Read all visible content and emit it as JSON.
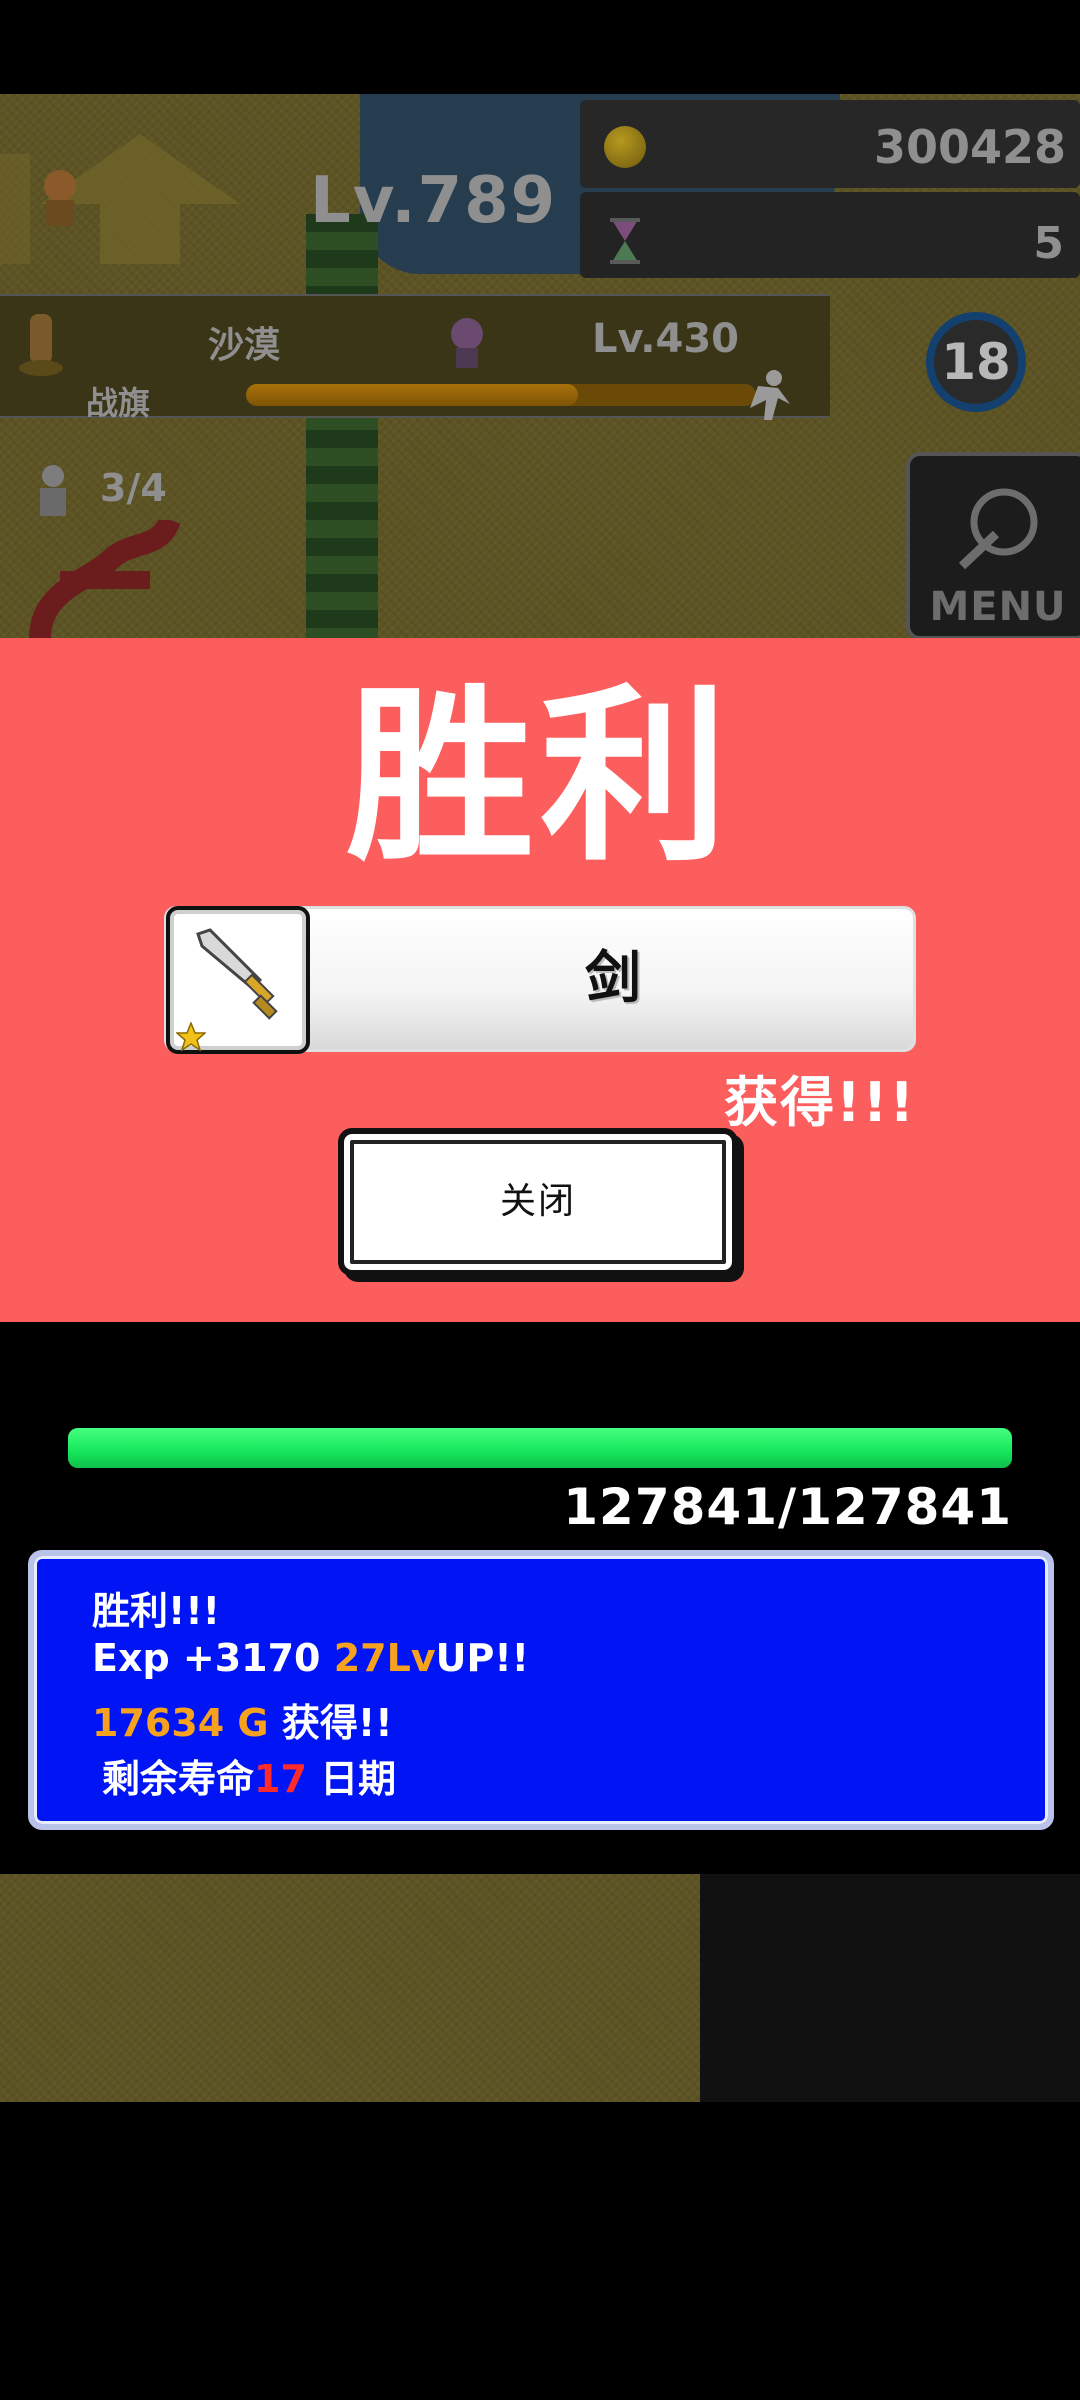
{
  "hud": {
    "player_level": "Lv.789",
    "gold": "300428",
    "hourglass": "5",
    "stage_name": "沙漠",
    "flag_label": "战旗",
    "enemy_level": "Lv.430",
    "stage_progress": 0.65,
    "round": "18",
    "party_count": "3/4",
    "menu_label": "MENU"
  },
  "modal": {
    "title": "胜利",
    "item_name": "剑",
    "obtained": "获得!!!",
    "close_label": "关闭",
    "background_color": "#fc5e5d"
  },
  "battle": {
    "hp_text": "127841/127841",
    "hp_fraction": 1.0
  },
  "log": {
    "line1": "胜利!!!",
    "line2_a": "Exp +3170 ",
    "line2_b": "27Lv",
    "line2_c": "UP!!",
    "line3_a": "17634 G ",
    "line3_b": "获得!!",
    "line4_a": "剩余寿命",
    "line4_b": "17",
    "line4_c": " 日期"
  },
  "icons": [
    "coin-icon",
    "hourglass-icon",
    "sword-icon",
    "star-icon",
    "menu-icon"
  ],
  "colors": {
    "hp_bar": "#14e65b",
    "log_background": "#0014f4",
    "accent_orange": "#f7a21e",
    "accent_red": "#ff2a2a"
  }
}
